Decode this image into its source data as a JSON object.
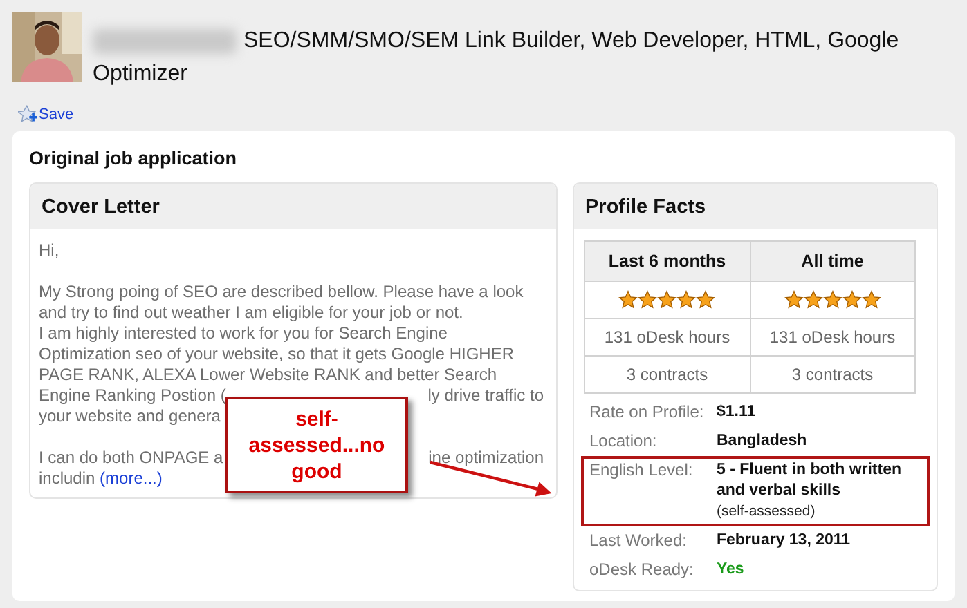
{
  "header": {
    "title_lines": [
      "SEO/SMM/SMO/SEM Link Builder, Web Developer, HTML, Google",
      "Optimizer"
    ],
    "save_label": "Save"
  },
  "application": {
    "title": "Original job application",
    "cover_letter": {
      "title": "Cover Letter",
      "paragraphs": [
        {
          "lines": [
            {
              "parts": [
                "Hi,"
              ]
            }
          ]
        },
        {
          "lines": [
            {
              "parts": [
                "My Strong poing of SEO are described bellow. Please have a look"
              ]
            },
            {
              "parts": [
                "and try to find out weather I am eligible for your job or not."
              ]
            },
            {
              "parts": [
                "I am highly interested to work for you for Search Engine"
              ]
            },
            {
              "parts": [
                "Optimization seo of your website, so that it gets Google HIGHER"
              ]
            },
            {
              "parts": [
                "PAGE RANK, ALEXA Lower Website RANK and better Search"
              ]
            },
            {
              "parts": [
                "Engine Ranking Postion (",
                "ly drive traffic to"
              ]
            },
            {
              "parts": [
                "your website and genera"
              ]
            }
          ]
        },
        {
          "lines": [
            {
              "parts": [
                "I can do both ONPAGE a",
                "ine optimization"
              ]
            },
            {
              "parts": [
                "includin"
              ],
              "link": "(more...)"
            }
          ]
        }
      ]
    },
    "profile_facts": {
      "title": "Profile Facts",
      "columns": [
        "Last 6 months",
        "All time"
      ],
      "rows": [
        {
          "kind": "stars",
          "cells": [
            {
              "stars": 5
            },
            {
              "stars": 5
            }
          ]
        },
        {
          "kind": "text",
          "cells": [
            {
              "text": "131 oDesk hours"
            },
            {
              "text": "131 oDesk hours"
            }
          ]
        },
        {
          "kind": "text",
          "cells": [
            {
              "text": "3 contracts"
            },
            {
              "text": "3 contracts"
            }
          ]
        }
      ],
      "facts": [
        {
          "label": "Rate on Profile:",
          "value": "$1.11",
          "highlighted": false
        },
        {
          "label": "Location:",
          "value": "Bangladesh",
          "highlighted": false
        },
        {
          "label": "English Level:",
          "value": "5 - Fluent in both written and verbal skills",
          "note": "(self-assessed)",
          "highlighted": true
        },
        {
          "label": "Last Worked:",
          "value": "February 13, 2011",
          "highlighted": false
        },
        {
          "label": "oDesk Ready:",
          "value": "Yes",
          "color": "#1a9a1a",
          "highlighted": false
        }
      ]
    }
  },
  "callout": {
    "text": "self-assessed...no good"
  }
}
